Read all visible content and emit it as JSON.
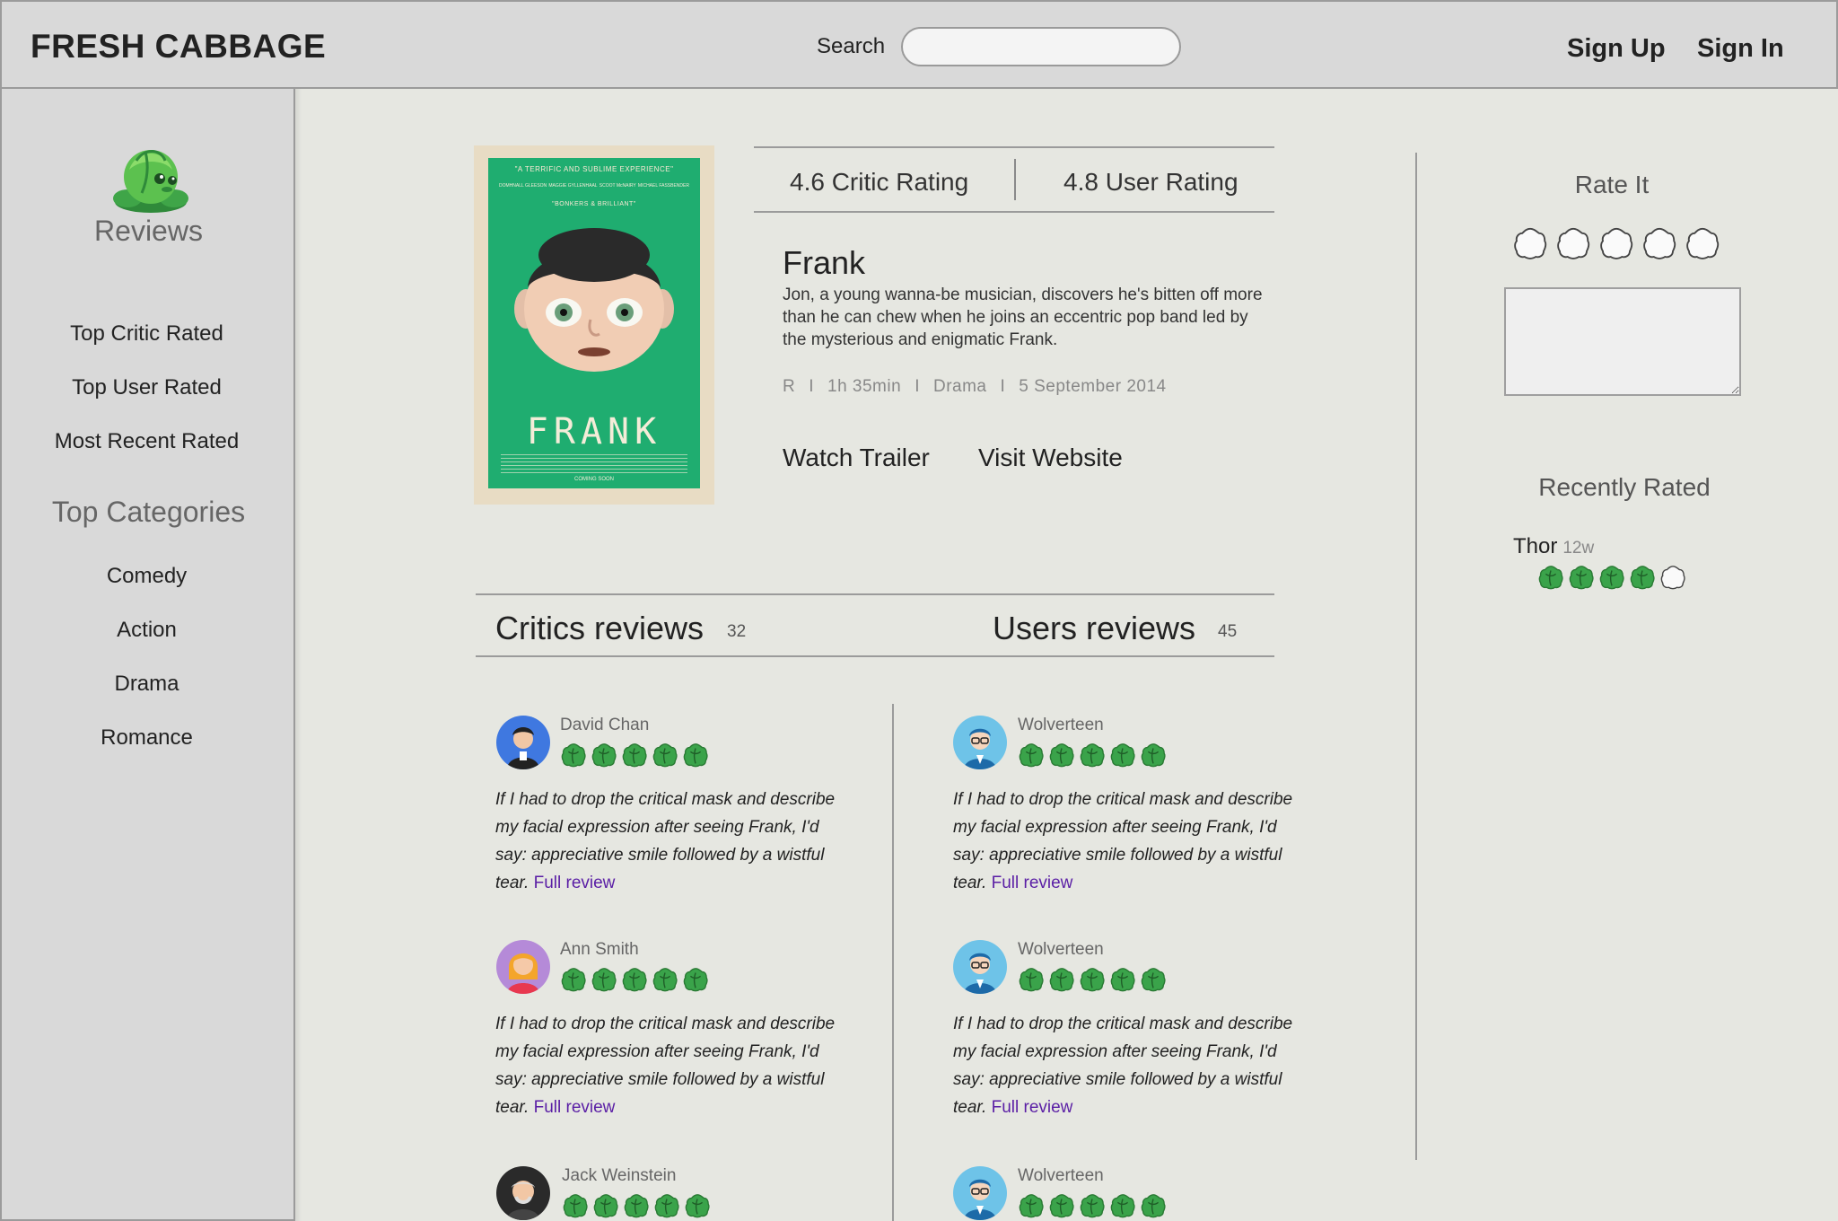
{
  "header": {
    "brand": "FRESH CABBAGE",
    "search_label": "Search",
    "search_placeholder": "",
    "sign_up": "Sign Up",
    "sign_in": "Sign In"
  },
  "sidebar": {
    "reviews_heading": "Reviews",
    "review_links": [
      "Top Critic Rated",
      "Top User Rated",
      "Most Recent Rated"
    ],
    "categories_heading": "Top Categories",
    "category_links": [
      "Comedy",
      "Action",
      "Drama",
      "Romance"
    ]
  },
  "movie": {
    "poster": {
      "tagline": "\"A TERRIFIC AND SUBLIME EXPERIENCE\"",
      "cast": [
        "DOMHNALL GLEESON",
        "MAGGIE GYLLENHAAL",
        "SCOOT McNAIRY",
        "MICHAEL FASSBENDER"
      ],
      "quote": "\"BONKERS & BRILLIANT\"",
      "title": "FRANK",
      "footer": "COMING SOON"
    },
    "critic_rating": "4.6 Critic Rating",
    "user_rating": "4.8 User Rating",
    "title": "Frank",
    "description": "Jon, a young wanna-be musician, discovers he's bitten off more than he can chew when he joins an eccentric pop band led by the mysterious and enigmatic Frank.",
    "meta": {
      "rating": "R",
      "runtime": "1h 35min",
      "genre": "Drama",
      "release": "5 September 2014",
      "separator": "I"
    },
    "watch_trailer": "Watch Trailer",
    "visit_website": "Visit Website"
  },
  "reviews": {
    "critics_label": "Critics reviews",
    "critics_count": "32",
    "users_label": "Users reviews",
    "users_count": "45",
    "full_review_label": "Full review",
    "critics": [
      {
        "name": "David Chan",
        "stars": 5,
        "avatar": "man-dark-hair-avatar",
        "text": "If I had to drop the critical mask and describe my facial expression after seeing Frank, I'd say: appreciative smile followed by a wistful tear."
      },
      {
        "name": "Ann Smith",
        "stars": 5,
        "avatar": "woman-blonde-avatar",
        "text": "If I had to drop the critical mask and describe my facial expression after seeing Frank, I'd say: appreciative smile followed by a wistful tear."
      },
      {
        "name": "Jack Weinstein",
        "stars": 5,
        "avatar": "old-man-avatar"
      }
    ],
    "users": [
      {
        "name": "Wolverteen",
        "stars": 5,
        "avatar": "man-glasses-avatar",
        "text": "If I had to drop the critical mask and describe my facial expression after seeing Frank, I'd say: appreciative smile followed by a wistful tear."
      },
      {
        "name": "Wolverteen",
        "stars": 5,
        "avatar": "man-glasses-avatar",
        "text": "If I had to drop the critical mask and describe my facial expression after seeing Frank, I'd say: appreciative smile followed by a wistful tear."
      },
      {
        "name": "Wolverteen",
        "stars": 5,
        "avatar": "man-glasses-avatar"
      }
    ]
  },
  "rate_panel": {
    "title": "Rate It",
    "stars": 0,
    "max_stars": 5,
    "recently_rated_title": "Recently Rated",
    "recent": [
      {
        "movie": "Thor",
        "age": "12w",
        "stars": 4,
        "max": 5
      }
    ]
  },
  "colors": {
    "cabbage_green": "#3aa34a",
    "full_review_link": "#5a1ea5",
    "background": "#e6e7e1",
    "panel": "#d9d9d9"
  }
}
